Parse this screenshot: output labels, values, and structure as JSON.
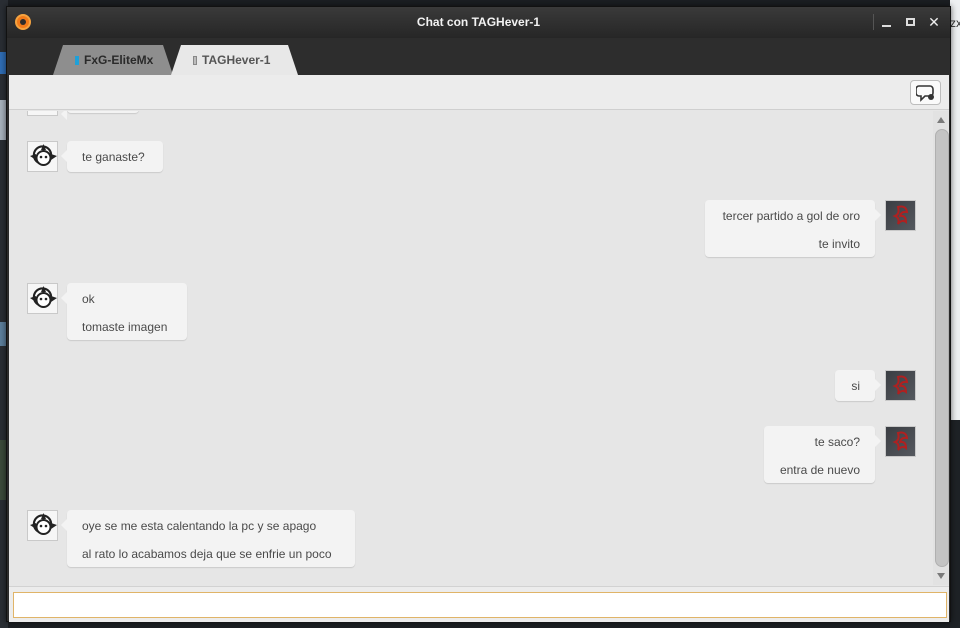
{
  "window": {
    "title": "Chat con TAGHever-1",
    "controls": [
      "minimize",
      "maximize",
      "close"
    ]
  },
  "tabs": [
    {
      "label": "FxG-EliteMx",
      "active": false,
      "status_color": "#1fa0d8"
    },
    {
      "label": "TAGHever-1",
      "active": true,
      "status_color": "#bcbcbc"
    }
  ],
  "toolbar": {
    "chat_options_icon": "speech-bubble-icon"
  },
  "messages": [
    {
      "from": "friend",
      "lines": [
        "te ganaste?"
      ]
    },
    {
      "from": "me",
      "lines": [
        "tercer partido a gol de oro",
        "te invito"
      ]
    },
    {
      "from": "friend",
      "lines": [
        "ok",
        "tomaste imagen"
      ]
    },
    {
      "from": "me",
      "lines": [
        "si"
      ]
    },
    {
      "from": "me",
      "lines": [
        "te saco?",
        "entra de nuevo"
      ]
    },
    {
      "from": "friend",
      "lines": [
        "oye se me esta calentando la pc y se apago",
        "al rato lo acabamos deja que se enfrie un poco"
      ]
    }
  ],
  "input": {
    "value": "",
    "placeholder": ""
  },
  "colors": {
    "accent": "#f07a1a",
    "input_border": "#e0b468"
  }
}
